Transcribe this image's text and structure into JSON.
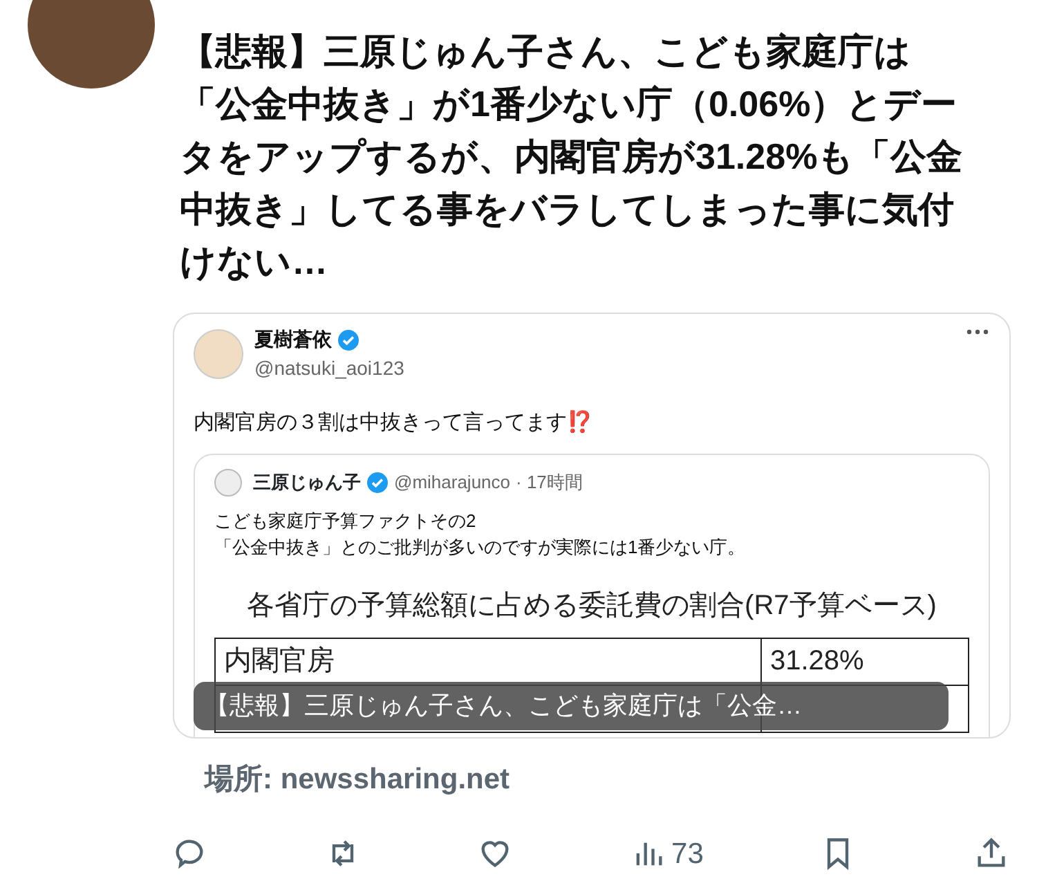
{
  "post": {
    "text": "【悲報】三原じゅん子さん、こども家庭庁は「公金中抜き」が1番少ない庁（0.06%）とデータをアップするが、内閣官房が31.28%も「公金中抜き」してる事をバラしてしまった事に気付けない…",
    "card": {
      "author": {
        "name": "夏樹蒼依",
        "verified": true,
        "handle": "@natsuki_aoi123"
      },
      "text": "内閣官房の３割は中抜きって言ってます⁉️",
      "quote": {
        "author": {
          "name": "三原じゅん子",
          "verified": true,
          "handle": "@miharajunco",
          "time": "· 17時間"
        },
        "lines": [
          "こども家庭庁予算ファクトその2",
          "「公金中抜き」とのご批判が多いのですが実際には1番少ない庁。"
        ],
        "table_title": "各省庁の予算総額に占める委託費の割合(R7予算ベース)",
        "rows": [
          {
            "label": "内閣官房",
            "value": "31.28%"
          }
        ]
      },
      "caption": "【悲報】三原じゅん子さん、こども家庭庁は「公金…"
    },
    "source": "場所: newssharing.net",
    "actions": [
      {
        "kind": "reply"
      },
      {
        "kind": "repost"
      },
      {
        "kind": "like"
      },
      {
        "kind": "views",
        "count": "73"
      },
      {
        "kind": "bookmark"
      },
      {
        "kind": "share"
      }
    ]
  }
}
